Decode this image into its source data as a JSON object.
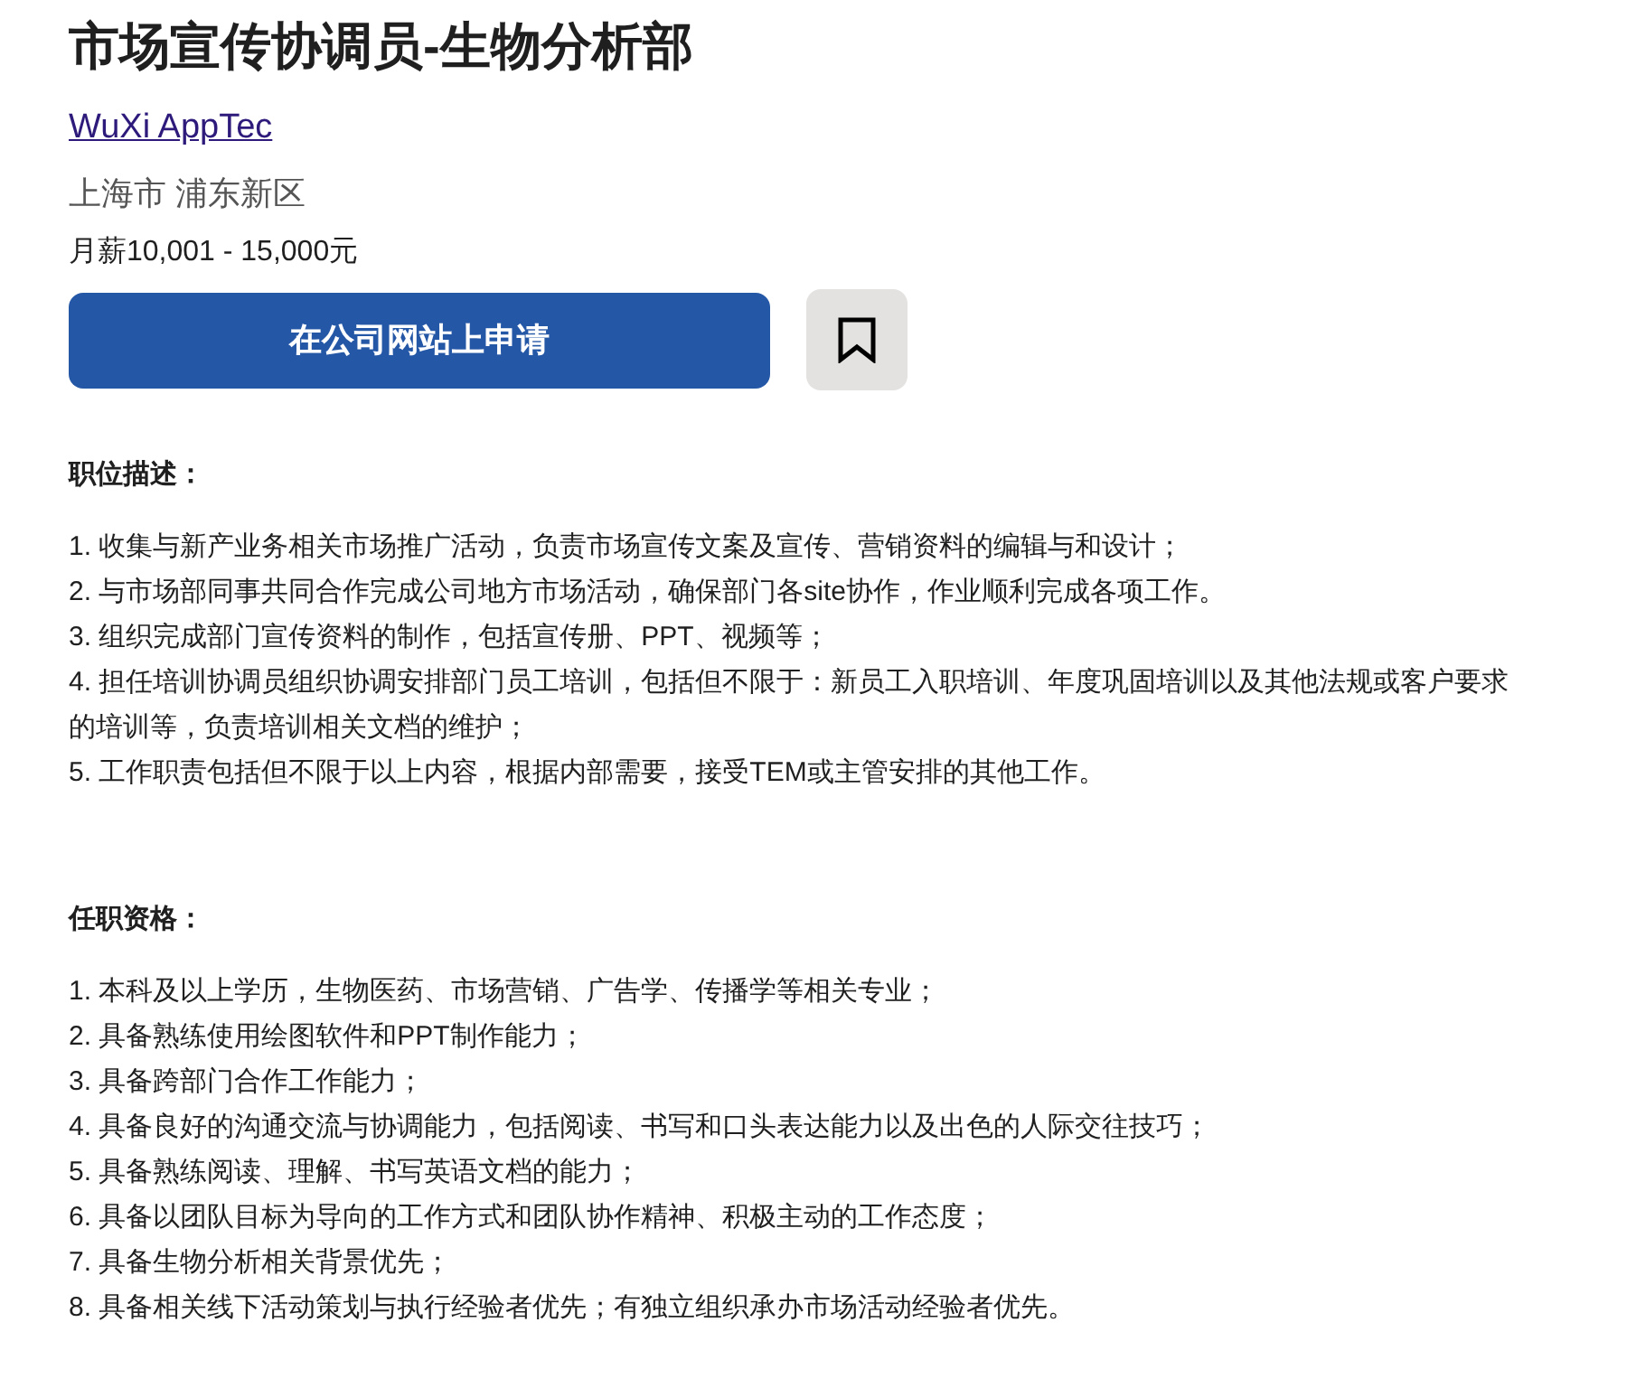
{
  "job": {
    "title": "市场宣传协调员-生物分析部",
    "company": "WuXi AppTec",
    "location": "上海市 浦东新区",
    "salary": "月薪10,001 - 15,000元"
  },
  "actions": {
    "apply_button": "在公司网站上申请",
    "saved": false
  },
  "sections": [
    {
      "heading": "职位描述：",
      "items": [
        "1. 收集与新产业务相关市场推广活动，负责市场宣传文案及宣传、营销资料的编辑与和设计；",
        "2. 与市场部同事共同合作完成公司地方市场活动，确保部门各site协作，作业顺利完成各项工作。",
        "3. 组织完成部门宣传资料的制作，包括宣传册、PPT、视频等；",
        "4. 担任培训协调员组织协调安排部门员工培训，包括但不限于：新员工入职培训、年度巩固培训以及其他法规或客户要求的培训等，负责培训相关文档的维护；",
        "5. 工作职责包括但不限于以上内容，根据内部需要，接受TEM或主管安排的其他工作。"
      ]
    },
    {
      "heading": "任职资格：",
      "items": [
        "1. 本科及以上学历，生物医药、市场营销、广告学、传播学等相关专业；",
        "2. 具备熟练使用绘图软件和PPT制作能力；",
        "3. 具备跨部门合作工作能力；",
        "4. 具备良好的沟通交流与协调能力，包括阅读、书写和口头表达能力以及出色的人际交往技巧；",
        "5. 具备熟练阅读、理解、书写英语文档的能力；",
        "6. 具备以团队目标为导向的工作方式和团队协作精神、积极主动的工作态度；",
        "7. 具备生物分析相关背景优先；",
        "8. 具备相关线下活动策划与执行经验者优先；有独立组织承办市场活动经验者优先。"
      ]
    }
  ]
}
